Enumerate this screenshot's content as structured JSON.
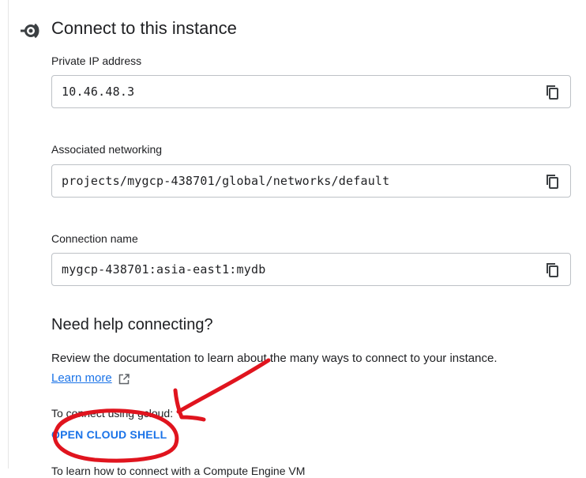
{
  "section": {
    "title": "Connect to this instance",
    "icon": "connection-plug-icon"
  },
  "fields": [
    {
      "label": "Private IP address",
      "value": "10.46.48.3",
      "copy_icon": "copy-icon"
    },
    {
      "label": "Associated networking",
      "value": "projects/mygcp-438701/global/networks/default",
      "copy_icon": "copy-icon"
    },
    {
      "label": "Connection name",
      "value": "mygcp-438701:asia-east1:mydb",
      "copy_icon": "copy-icon"
    }
  ],
  "help": {
    "heading": "Need help connecting?",
    "description": "Review the documentation to learn about the many ways to connect to your instance.",
    "learn_more": "Learn more",
    "learn_more_icon": "open-in-new-icon",
    "gcloud_text": "To connect using gcloud:",
    "open_shell": "OPEN CLOUD SHELL",
    "next_text_partial": "To learn how to connect with a Compute Engine VM"
  },
  "colors": {
    "link": "#1a73e8",
    "border": "#bdc1c6",
    "annotation": "#e0141e"
  }
}
